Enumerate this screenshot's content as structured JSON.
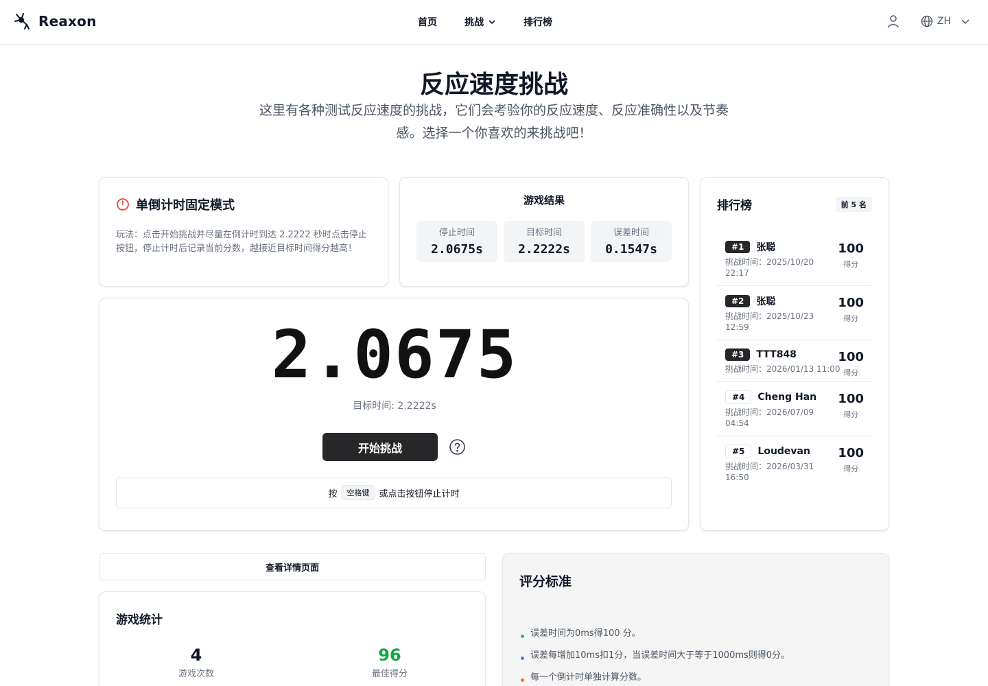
{
  "header": {
    "logo_text": "Reaxon",
    "nav": [
      {
        "label": "首页"
      },
      {
        "label": "挑战"
      },
      {
        "label": "排行榜"
      }
    ],
    "lang": "ZH"
  },
  "hero": {
    "title": "反应速度挑战",
    "subtitle": "这里有各种测试反应速度的挑战，它们会考验你的反应速度、反应准确性以及节奏感。选择一个你喜欢的来挑战吧！"
  },
  "mode": {
    "title": "单倒计时固定模式",
    "description": "玩法：点击开始挑战并尽量在倒计时到达 2.2222 秒时点击停止按钮，停止计时后记录当前分数，越接近目标时间得分越高！"
  },
  "result": {
    "title": "游戏结果",
    "boxes": [
      {
        "label": "停止时间",
        "value": "2.0675s"
      },
      {
        "label": "目标时间",
        "value": "2.2222s"
      },
      {
        "label": "误差时间",
        "value": "0.1547s"
      }
    ]
  },
  "timer": {
    "value": "2.0675",
    "target": "目标时间: 2.2222s",
    "start_label": "开始挑战",
    "hint_pre": "按",
    "hint_key": "空格键",
    "hint_post": "或点击按钮停止计时"
  },
  "leaderboard": {
    "title": "排行榜",
    "badge": "前 5 名",
    "score_unit": "得分",
    "entries": [
      {
        "rank": "#1",
        "name": "张聪",
        "time": "挑战时间：2025/10/20 22:17",
        "score": "100"
      },
      {
        "rank": "#2",
        "name": "张聪",
        "time": "挑战时间：2025/10/23 12:59",
        "score": "100"
      },
      {
        "rank": "#3",
        "name": "TTT848",
        "time": "挑战时间：2026/01/13 11:00",
        "score": "100"
      },
      {
        "rank": "#4",
        "name": "Cheng Han",
        "time": "挑战时间：2026/07/09 04:54",
        "score": "100"
      },
      {
        "rank": "#5",
        "name": "Loudevan",
        "time": "挑战时间：2026/03/31 16:50",
        "score": "100"
      }
    ]
  },
  "detail_button": "查看详情页面",
  "stats": {
    "title": "游戏统计",
    "items": [
      {
        "value": "4",
        "label": "游戏次数"
      },
      {
        "value": "96",
        "label": "最佳得分"
      }
    ]
  },
  "rules": {
    "title": "评分标准",
    "items": [
      {
        "text": "误差时间为0ms得100 分。",
        "color": "#22c55e"
      },
      {
        "text": "误差每增加10ms扣1分，当误差时间大于等于1000ms则得0分。",
        "color": "#3b82f6"
      },
      {
        "text": "每一个倒计时单独计算分数。",
        "color": "#f97316"
      }
    ]
  },
  "colors": {
    "accent_dark": "#27272a",
    "clock_icon": "#ef4444",
    "best_score": "#16a34a"
  }
}
